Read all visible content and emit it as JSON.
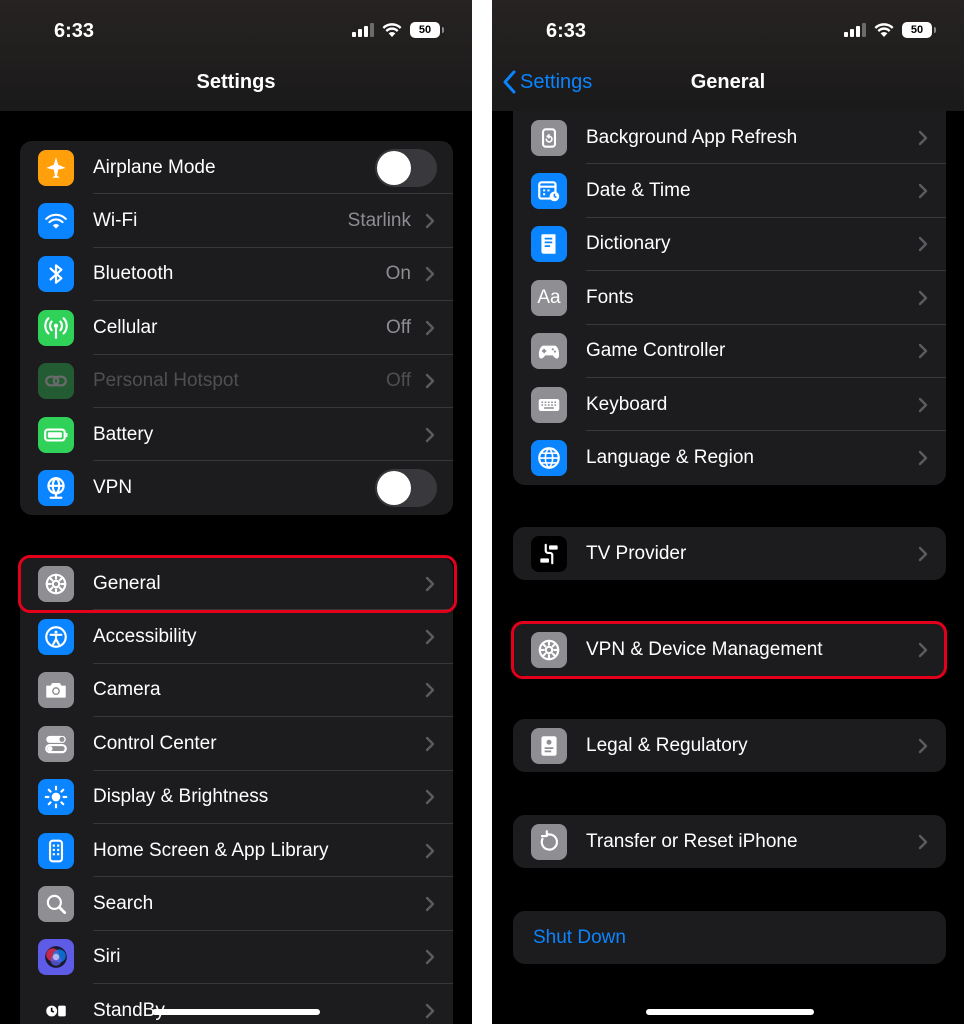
{
  "status_bar": {
    "time": "6:33",
    "battery": "50"
  },
  "left": {
    "title": "Settings",
    "group1": [
      {
        "label": "Airplane Mode",
        "icon": "airplane-icon",
        "color": "#ff9f0a",
        "toggle": "off"
      },
      {
        "label": "Wi-Fi",
        "value": "Starlink",
        "icon": "wifi-icon",
        "color": "#0a84ff"
      },
      {
        "label": "Bluetooth",
        "value": "On",
        "icon": "bluetooth-icon",
        "color": "#0a84ff"
      },
      {
        "label": "Cellular",
        "value": "Off",
        "icon": "antenna-icon",
        "color": "#30d158"
      },
      {
        "label": "Personal Hotspot",
        "value": "Off",
        "icon": "link-icon",
        "color": "#30d158",
        "disabled": true
      },
      {
        "label": "Battery",
        "icon": "battery-icon",
        "color": "#30d158"
      },
      {
        "label": "VPN",
        "icon": "globe-network-icon",
        "color": "#0a84ff",
        "toggle": "off"
      }
    ],
    "group2": [
      {
        "label": "General",
        "icon": "gear-icon",
        "color": "#8e8e93",
        "highlighted": true
      },
      {
        "label": "Accessibility",
        "icon": "accessibility-icon",
        "color": "#0a84ff"
      },
      {
        "label": "Camera",
        "icon": "camera-icon",
        "color": "#8e8e93"
      },
      {
        "label": "Control Center",
        "icon": "switches-icon",
        "color": "#8e8e93"
      },
      {
        "label": "Display & Brightness",
        "icon": "sun-icon",
        "color": "#0a84ff"
      },
      {
        "label": "Home Screen & App Library",
        "icon": "phone-grid-icon",
        "color": "#0a84ff"
      },
      {
        "label": "Search",
        "icon": "search-icon",
        "color": "#8e8e93"
      },
      {
        "label": "Siri",
        "icon": "siri-icon",
        "color": "#5e5ce6"
      },
      {
        "label": "StandBy",
        "icon": "standby-icon",
        "color": "#1c1c1e"
      }
    ]
  },
  "right": {
    "back_label": "Settings",
    "title": "General",
    "group1": [
      {
        "label": "Background App Refresh",
        "icon": "refresh-icon",
        "color": "#8e8e93"
      },
      {
        "label": "Date & Time",
        "icon": "calendar-clock-icon",
        "color": "#0a84ff"
      },
      {
        "label": "Dictionary",
        "icon": "book-icon",
        "color": "#0a84ff"
      },
      {
        "label": "Fonts",
        "icon": "fonts-icon",
        "color": "#8e8e93",
        "glyph": "Aa"
      },
      {
        "label": "Game Controller",
        "icon": "gamepad-icon",
        "color": "#8e8e93"
      },
      {
        "label": "Keyboard",
        "icon": "keyboard-icon",
        "color": "#8e8e93"
      },
      {
        "label": "Language & Region",
        "icon": "globe-icon",
        "color": "#0a84ff"
      }
    ],
    "tv_provider": {
      "label": "TV Provider",
      "icon": "tv-provider-icon",
      "color": "#000000"
    },
    "vpn_device": {
      "label": "VPN & Device Management",
      "icon": "gear-icon",
      "color": "#8e8e93",
      "highlighted": true
    },
    "legal": {
      "label": "Legal & Regulatory",
      "icon": "document-icon",
      "color": "#8e8e93"
    },
    "transfer": {
      "label": "Transfer or Reset iPhone",
      "icon": "reset-icon",
      "color": "#8e8e93"
    },
    "shutdown_label": "Shut Down"
  },
  "colors": {
    "accent": "#0a84ff",
    "highlight": "#e3001b",
    "cell": "#1c1c1e"
  }
}
